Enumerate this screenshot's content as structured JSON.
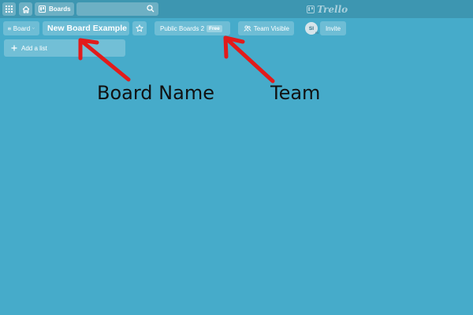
{
  "topbar": {
    "boards_label": "Boards",
    "logo_text": "Trello",
    "icons": [
      "apps-icon",
      "home-icon",
      "boards-icon",
      "search-icon"
    ]
  },
  "board_header": {
    "board_menu_label": "Board",
    "board_name": "New Board Example",
    "team_name": "Public Boards 2",
    "team_badge": "Free",
    "visibility_label": "Team Visible",
    "member_initials": "SI",
    "member_sub": "m",
    "invite_label": "Invite"
  },
  "lists": {
    "add_list_label": "Add a list"
  },
  "annotations": {
    "board_name_label": "Board Name",
    "team_label": "Team"
  },
  "colors": {
    "background": "#46abca",
    "topbar": "#3d96b1",
    "arrow": "#e21b1b"
  }
}
